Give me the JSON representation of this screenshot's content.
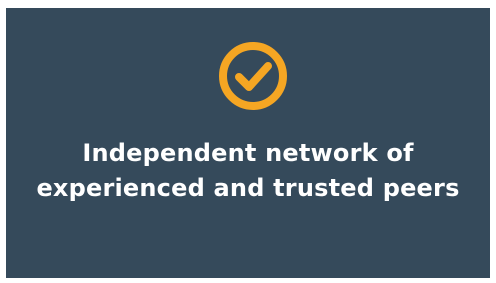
{
  "card": {
    "icon": "check-circle-icon",
    "headline_line1": "Independent network of",
    "headline_line2": "experienced and trusted peers"
  },
  "colors": {
    "background": "#354a5b",
    "accent": "#f5a623",
    "text": "#ffffff"
  }
}
